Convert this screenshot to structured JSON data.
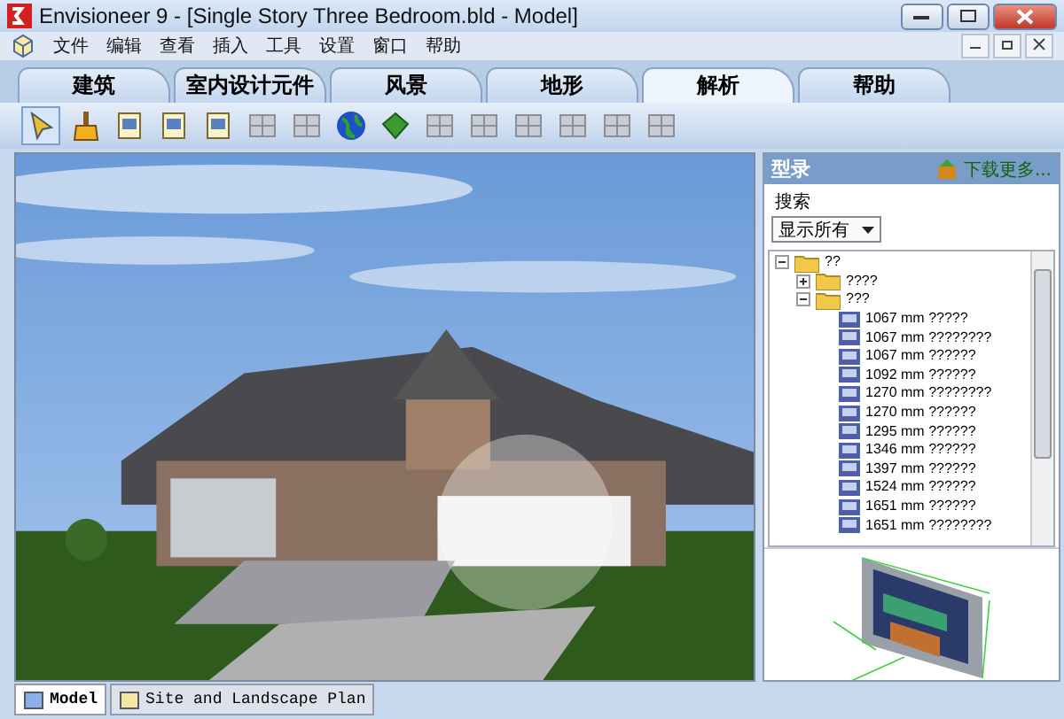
{
  "window": {
    "title": "Envisioneer 9 - [Single Story Three Bedroom.bld - Model]"
  },
  "menu": [
    "文件",
    "编辑",
    "查看",
    "插入",
    "工具",
    "设置",
    "窗口",
    "帮助"
  ],
  "tabs": [
    {
      "label": "建筑",
      "selected": false
    },
    {
      "label": "室内设计元件",
      "selected": false
    },
    {
      "label": "风景",
      "selected": false
    },
    {
      "label": "地形",
      "selected": false
    },
    {
      "label": "解析",
      "selected": true
    },
    {
      "label": "帮助",
      "selected": false
    }
  ],
  "tools": [
    {
      "kind": "pointer",
      "selected": true
    },
    {
      "kind": "brush",
      "selected": false
    },
    {
      "kind": "doc",
      "selected": false
    },
    {
      "kind": "doc",
      "selected": false
    },
    {
      "kind": "doc",
      "selected": false
    },
    {
      "kind": "grey",
      "selected": false
    },
    {
      "kind": "grey",
      "selected": false
    },
    {
      "kind": "globe",
      "selected": false
    },
    {
      "kind": "gem",
      "selected": false
    },
    {
      "kind": "grey",
      "selected": false
    },
    {
      "kind": "grey",
      "selected": false
    },
    {
      "kind": "grey",
      "selected": false
    },
    {
      "kind": "grey",
      "selected": false
    },
    {
      "kind": "grey",
      "selected": false
    },
    {
      "kind": "grey",
      "selected": false
    }
  ],
  "catalog": {
    "title": "型录",
    "download": "下载更多...",
    "search_label": "搜索",
    "filter": "显示所有",
    "tree": [
      {
        "label": "??",
        "expanded": true,
        "children": [
          {
            "label": "????",
            "expanded": false
          },
          {
            "label": "???",
            "expanded": true,
            "children": [
              {
                "label": "1067 mm ?????"
              },
              {
                "label": "1067 mm ????????"
              },
              {
                "label": "1067 mm ??????"
              },
              {
                "label": "1092 mm ??????"
              },
              {
                "label": "1270 mm ????????"
              },
              {
                "label": "1270 mm ??????"
              },
              {
                "label": "1295 mm ??????"
              },
              {
                "label": "1346 mm ??????"
              },
              {
                "label": "1397 mm ??????"
              },
              {
                "label": "1524 mm ??????"
              },
              {
                "label": "1651 mm ??????"
              },
              {
                "label": "1651 mm ????????"
              }
            ]
          }
        ]
      }
    ]
  },
  "view_tabs": [
    {
      "label": "Model",
      "selected": true
    },
    {
      "label": "Site and Landscape Plan",
      "selected": false
    }
  ]
}
